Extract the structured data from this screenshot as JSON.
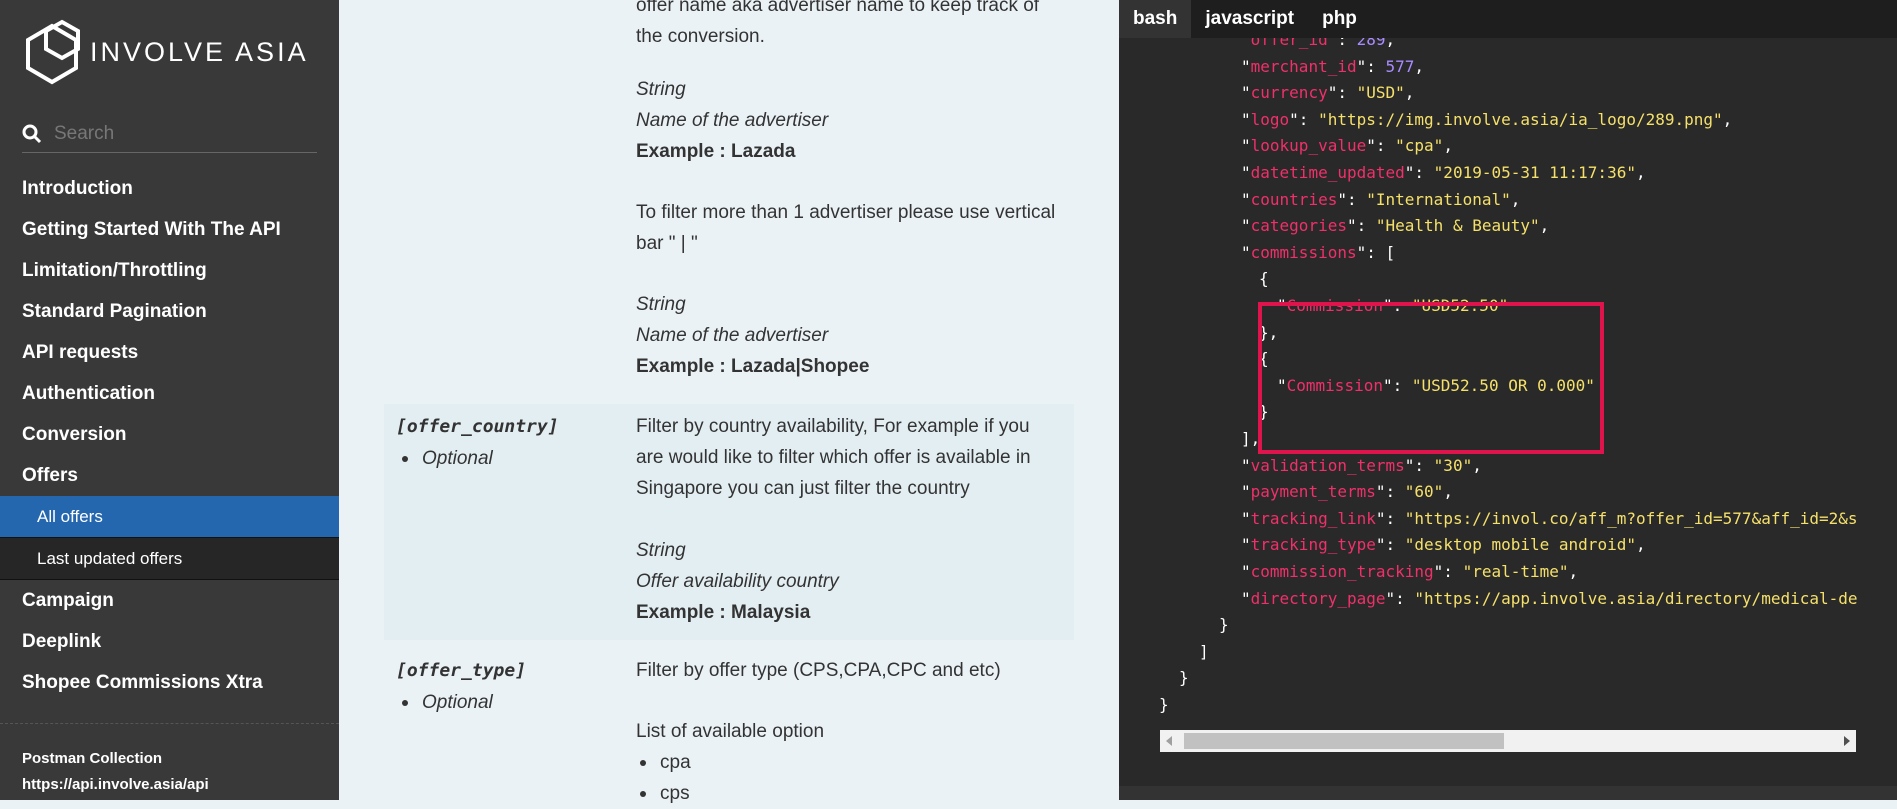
{
  "brand": {
    "name": "INVOLVE ASIA"
  },
  "search": {
    "placeholder": "Search"
  },
  "nav": {
    "items": [
      "Introduction",
      "Getting Started With The API",
      "Limitation/Throttling",
      "Standard Pagination",
      "API requests",
      "Authentication",
      "Conversion",
      "Offers"
    ],
    "sub_items": [
      "All offers",
      "Last updated offers"
    ],
    "active_sub": "All offers",
    "items_after": [
      "Campaign",
      "Deeplink",
      "Shopee Commissions Xtra"
    ]
  },
  "postman": {
    "title": "Postman Collection",
    "url": "https://api.involve.asia/api"
  },
  "content": {
    "top_line1": "offer name aka advertiser name to keep track of",
    "top_line2": "the conversion.",
    "block1": {
      "type": "String",
      "desc": "Name of the advertiser",
      "example": "Example : Lazada"
    },
    "filter_note1": "To filter more than 1 advertiser please use vertical",
    "filter_note2": "bar \" | \"",
    "block2": {
      "type": "String",
      "desc": "Name of the advertiser",
      "example": "Example : Lazada|Shopee"
    },
    "offer_country": {
      "param": "[offer_country]",
      "optional": "Optional",
      "line1": "Filter by country availability, For example if you",
      "line2": "are would like to filter which offer is available in",
      "line3": "Singapore you can just filter the country",
      "type": "String",
      "desc": "Offer availability country",
      "example": "Example : Malaysia"
    },
    "offer_type": {
      "param": "[offer_type]",
      "optional": "Optional",
      "line1": "Filter by offer type (CPS,CPA,CPC and etc)",
      "list_title": "List of available option",
      "options": [
        "cpa",
        "cps"
      ]
    }
  },
  "code": {
    "tabs": [
      "bash",
      "javascript",
      "php"
    ],
    "active_tab": "bash",
    "pairs": [
      {
        "key": "offer_id",
        "value": "289",
        "num": true
      },
      {
        "key": "merchant_id",
        "value": "577",
        "num": true
      },
      {
        "key": "currency",
        "value": "\"USD\"",
        "num": false
      },
      {
        "key": "logo",
        "value": "\"https://img.involve.asia/ia_logo/289.png\"",
        "num": false
      },
      {
        "key": "lookup_value",
        "value": "\"cpa\"",
        "num": false
      },
      {
        "key": "datetime_updated",
        "value": "\"2019-05-31 11:17:36\"",
        "num": false
      },
      {
        "key": "countries",
        "value": "\"International\"",
        "num": false
      },
      {
        "key": "categories",
        "value": "\"Health & Beauty\"",
        "num": false
      }
    ],
    "commissions_key": "commissions",
    "commission_entries": [
      {
        "key": "Commission",
        "value": "\"USD52.50\""
      },
      {
        "key": "Commission",
        "value": "\"USD52.50 OR 0.000\""
      }
    ],
    "pairs_after": [
      {
        "key": "validation_terms",
        "value": "\"30\""
      },
      {
        "key": "payment_terms",
        "value": "\"60\""
      },
      {
        "key": "tracking_link",
        "value": "\"https://invol.co/aff_m?offer_id=577&aff_id=2&s"
      },
      {
        "key": "tracking_type",
        "value": "\"desktop mobile android\""
      },
      {
        "key": "commission_tracking",
        "value": "\"real-time\""
      },
      {
        "key": "directory_page",
        "value": "\"https://app.involve.asia/directory/medical-de"
      }
    ]
  },
  "colors": {
    "sidebar": "#393939",
    "active": "#2467af",
    "highlight": "#e0144c",
    "key": "#f0306a",
    "string": "#f5e06a",
    "number": "#a98cff"
  }
}
